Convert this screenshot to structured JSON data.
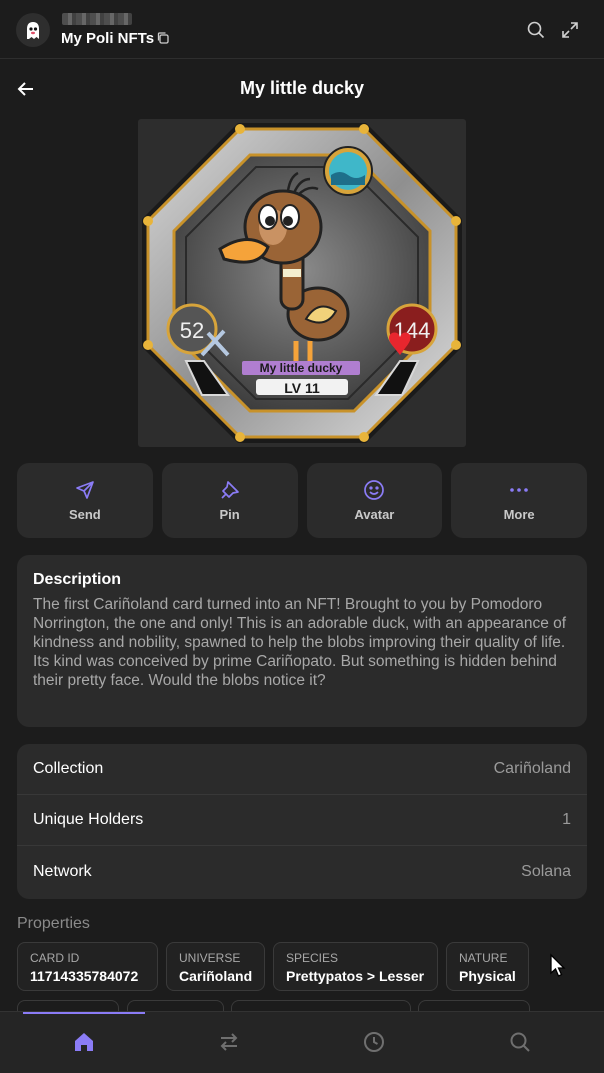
{
  "header": {
    "account_name": "My Poli NFTs",
    "icons": [
      "avatar-icon",
      "copy-icon",
      "search-icon",
      "expand-icon"
    ]
  },
  "page": {
    "title": "My little ducky",
    "card": {
      "name_banner": "My little ducky",
      "level": "LV 11",
      "attack": "52",
      "health": "144"
    }
  },
  "actions": [
    {
      "label": "Send",
      "icon": "send-icon"
    },
    {
      "label": "Pin",
      "icon": "pin-icon"
    },
    {
      "label": "Avatar",
      "icon": "smiley-icon"
    },
    {
      "label": "More",
      "icon": "more-icon"
    }
  ],
  "description": {
    "title": "Description",
    "body": "The first Cariñoland card turned into an NFT! Brought to you by Pomodoro Norrington, the one and only! This is an adorable duck, with an appearance of kindness and nobility, spawned to help the blobs improving their quality of life. Its kind was conceived by prime Cariñopato. But something is hidden behind their pretty face. Would the blobs notice it?"
  },
  "info": [
    {
      "label": "Collection",
      "value": "Cariñoland"
    },
    {
      "label": "Unique Holders",
      "value": "1"
    },
    {
      "label": "Network",
      "value": "Solana"
    }
  ],
  "properties": {
    "title": "Properties",
    "items": [
      {
        "key": "CARD ID",
        "value": "11714335784072"
      },
      {
        "key": "UNIVERSE",
        "value": "Cariñoland"
      },
      {
        "key": "SPECIES",
        "value": "Prettypatos > Lesser"
      },
      {
        "key": "NATURE",
        "value": "Physical"
      }
    ]
  },
  "bottom_nav": [
    "home-icon",
    "swap-icon",
    "history-icon",
    "search-icon"
  ],
  "colors": {
    "accent": "#8b7cf6",
    "background": "#1c1c1c",
    "card": "#2b2b2b"
  }
}
